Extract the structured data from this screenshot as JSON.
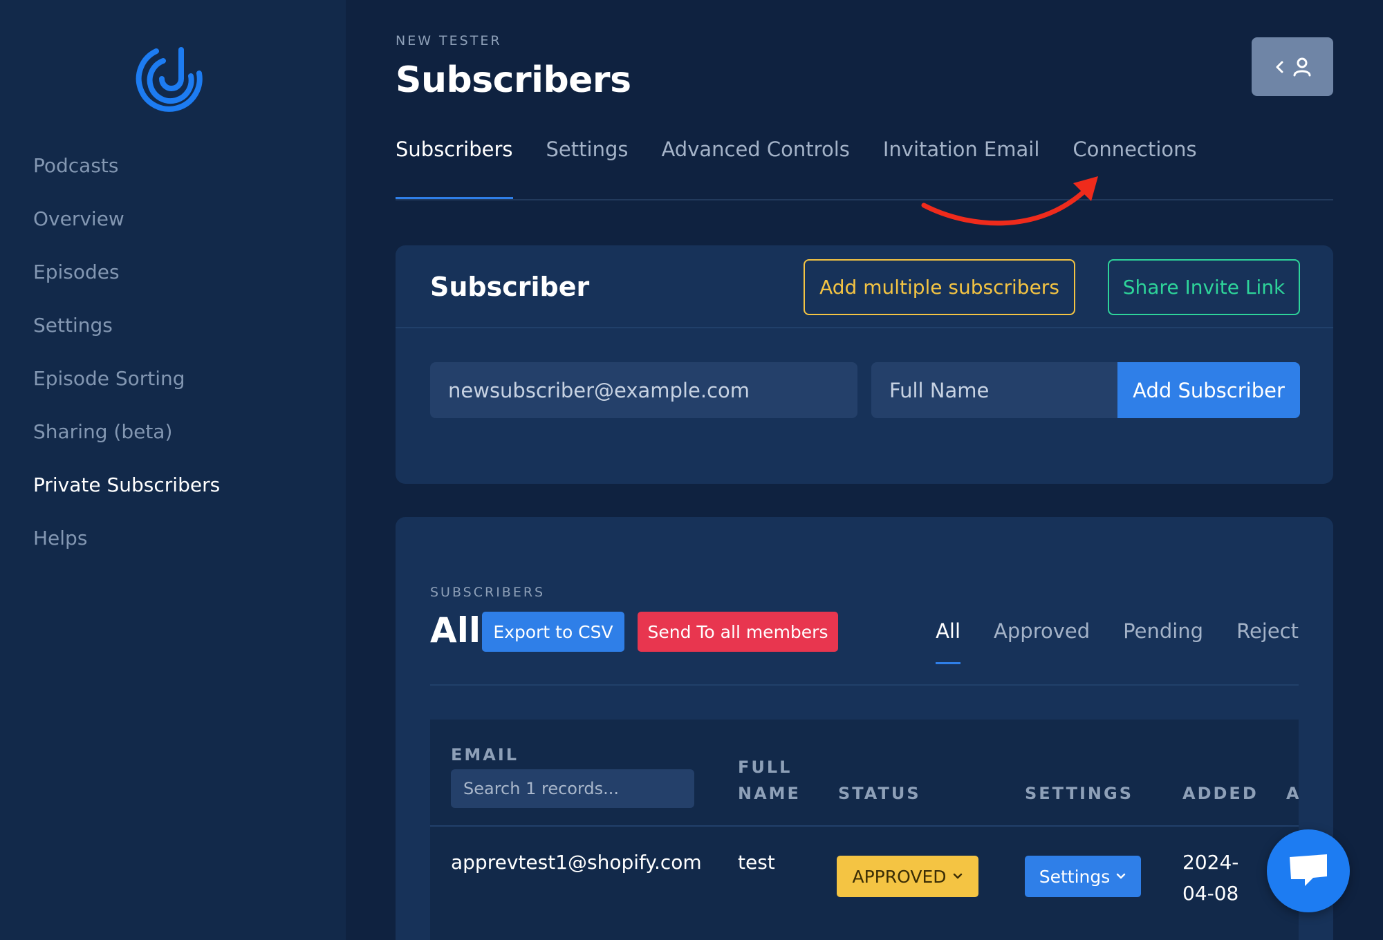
{
  "sidebar": {
    "items": [
      {
        "label": "Podcasts"
      },
      {
        "label": "Overview"
      },
      {
        "label": "Episodes"
      },
      {
        "label": "Settings"
      },
      {
        "label": "Episode Sorting"
      },
      {
        "label": "Sharing (beta)"
      },
      {
        "label": "Private Subscribers",
        "active": true
      },
      {
        "label": "Helps"
      }
    ]
  },
  "header": {
    "eyebrow": "NEW TESTER",
    "title": "Subscribers",
    "profile_icons": [
      "chevron-left-icon",
      "user-icon"
    ]
  },
  "tabs": [
    {
      "label": "Subscribers",
      "active": true
    },
    {
      "label": "Settings"
    },
    {
      "label": "Advanced Controls"
    },
    {
      "label": "Invitation Email"
    },
    {
      "label": "Connections"
    }
  ],
  "subscriber_card": {
    "title": "Subscriber",
    "add_multiple_label": "Add multiple subscribers",
    "share_link_label": "Share Invite Link",
    "email_placeholder": "newsubscriber@example.com",
    "name_placeholder": "Full Name",
    "add_button_label": "Add Subscriber"
  },
  "list_card": {
    "eyebrow": "SUBSCRIBERS",
    "heading": "All",
    "export_label": "Export to CSV",
    "send_label": "Send To all members",
    "filters": [
      {
        "label": "All",
        "active": true
      },
      {
        "label": "Approved"
      },
      {
        "label": "Pending"
      },
      {
        "label": "Reject"
      }
    ],
    "table": {
      "columns": {
        "email": "EMAIL",
        "full_name_1": "FULL",
        "full_name_2": "NAME",
        "status": "STATUS",
        "settings": "SETTINGS",
        "added": "ADDED",
        "extra": "A"
      },
      "search_placeholder": "Search 1 records...",
      "rows": [
        {
          "email": "apprevtest1@shopify.com",
          "full_name": "test",
          "status": "APPROVED",
          "settings": "Settings",
          "added_1": "2024-",
          "added_2": "04-08"
        }
      ]
    }
  },
  "colors": {
    "background": "#0f2240",
    "sidebar": "#12294a",
    "card": "#173259",
    "primary": "#2f7fe8",
    "warning": "#f4c443",
    "success": "#2ed49a",
    "danger": "#e8364f",
    "annotation": "#ef2b1c"
  }
}
